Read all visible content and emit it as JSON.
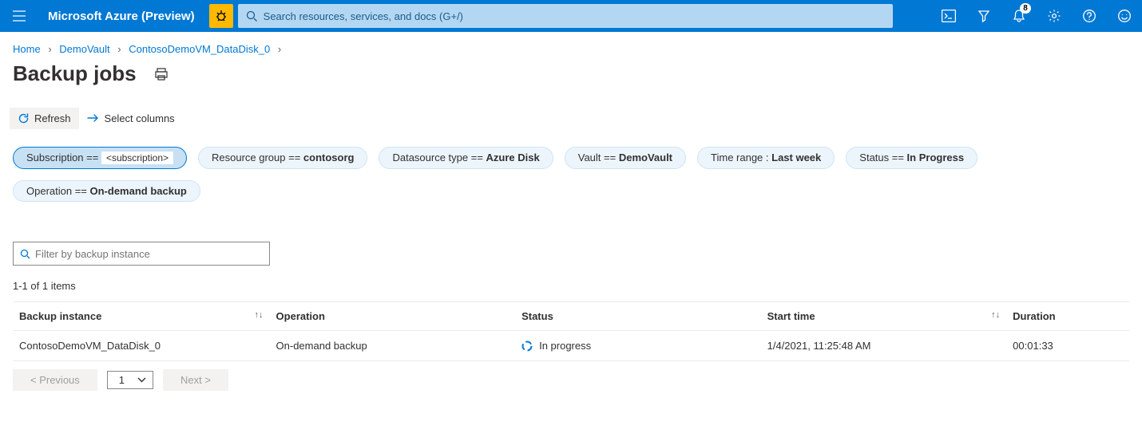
{
  "topbar": {
    "brand": "Microsoft Azure (Preview)",
    "search_placeholder": "Search resources, services, and docs (G+/)",
    "notification_count": "8"
  },
  "breadcrumb": {
    "home": "Home",
    "vault": "DemoVault",
    "resource": "ContosoDemoVM_DataDisk_0"
  },
  "title": "Backup jobs",
  "toolbar": {
    "refresh": "Refresh",
    "select_columns": "Select columns"
  },
  "filters": {
    "subscription_key": "Subscription == ",
    "subscription_val": "<subscription>",
    "rg_key": "Resource group == ",
    "rg_val": "contosorg",
    "ds_key": "Datasource type == ",
    "ds_val": "Azure Disk",
    "vault_key": "Vault == ",
    "vault_val": "DemoVault",
    "time_key": "Time range : ",
    "time_val": "Last week",
    "status_key": "Status == ",
    "status_val": "In Progress",
    "op_key": "Operation == ",
    "op_val": "On-demand backup"
  },
  "instance_filter_placeholder": "Filter by backup instance",
  "count_text": "1-1 of 1 items",
  "columns": {
    "instance": "Backup instance",
    "operation": "Operation",
    "status": "Status",
    "start": "Start time",
    "duration": "Duration"
  },
  "rows": [
    {
      "instance": "ContosoDemoVM_DataDisk_0",
      "operation": "On-demand backup",
      "status": "In progress",
      "start": "1/4/2021, 11:25:48 AM",
      "duration": "00:01:33"
    }
  ],
  "pager": {
    "prev": "<  Previous",
    "page": "1",
    "next": "Next  >"
  }
}
